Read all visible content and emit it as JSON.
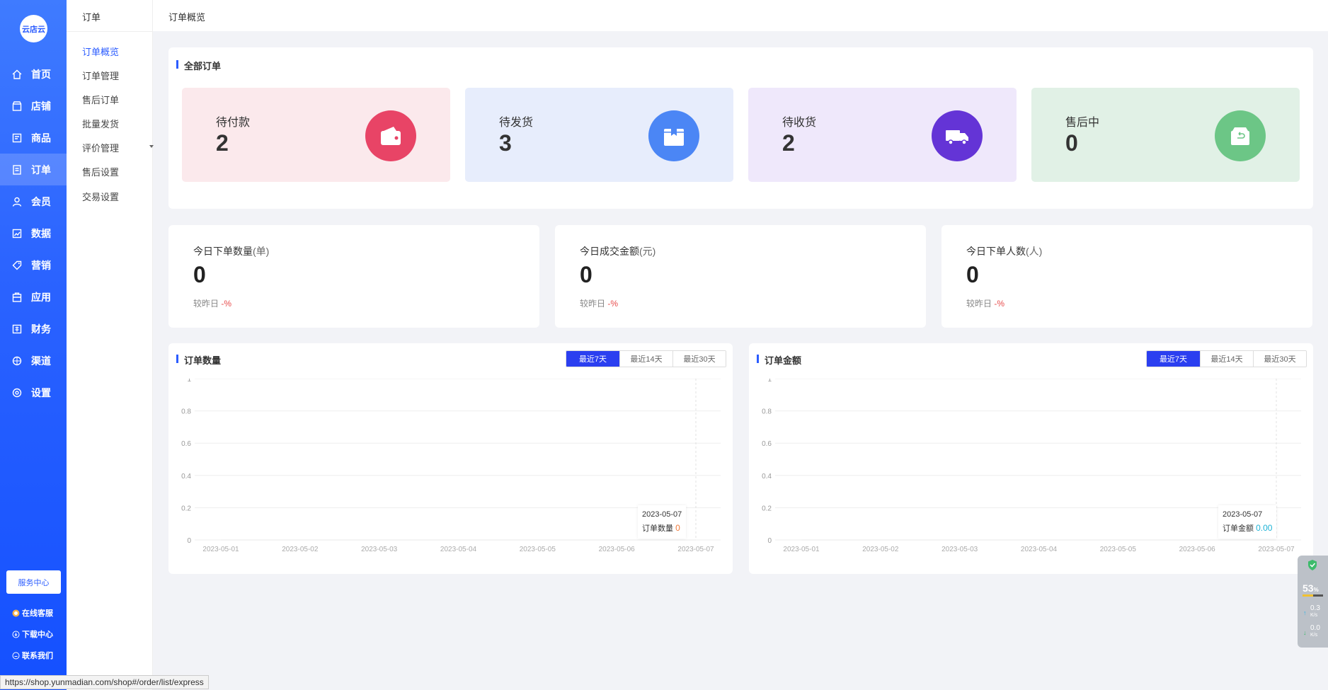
{
  "brand": {
    "logo_text": "云店云"
  },
  "nav": {
    "items": [
      {
        "label": "首页",
        "icon": "home-icon"
      },
      {
        "label": "店铺",
        "icon": "store-icon"
      },
      {
        "label": "商品",
        "icon": "goods-icon"
      },
      {
        "label": "订单",
        "icon": "order-icon"
      },
      {
        "label": "会员",
        "icon": "member-icon"
      },
      {
        "label": "数据",
        "icon": "data-icon"
      },
      {
        "label": "营销",
        "icon": "tag-icon"
      },
      {
        "label": "应用",
        "icon": "app-icon"
      },
      {
        "label": "财务",
        "icon": "finance-icon"
      },
      {
        "label": "渠道",
        "icon": "channel-icon"
      },
      {
        "label": "设置",
        "icon": "gear-icon"
      }
    ],
    "active": "订单",
    "service_center": "服务中心",
    "links": [
      {
        "label": "在线客服",
        "icon": "chat-icon"
      },
      {
        "label": "下载中心",
        "icon": "download-icon"
      },
      {
        "label": "联系我们",
        "icon": "contact-icon"
      }
    ]
  },
  "subnav": {
    "title": "订单",
    "items": [
      "订单概览",
      "订单管理",
      "售后订单",
      "批量发货",
      "评价管理",
      "售后设置",
      "交易设置"
    ],
    "active": "订单概览"
  },
  "header": {
    "breadcrumb": "订单概览"
  },
  "orders": {
    "title": "全部订单",
    "stats": [
      {
        "label": "待付款",
        "value": "2",
        "icon": "wallet-icon",
        "bg": "#fbe9ec",
        "circle": "#e84466"
      },
      {
        "label": "待发货",
        "value": "3",
        "icon": "box-icon",
        "bg": "#e7edfc",
        "circle": "#4b86f5"
      },
      {
        "label": "待收货",
        "value": "2",
        "icon": "truck-icon",
        "bg": "#efe8fb",
        "circle": "#6434d6"
      },
      {
        "label": "售后中",
        "value": "0",
        "icon": "return-box-icon",
        "bg": "#e1f1e6",
        "circle": "#6cc686"
      }
    ]
  },
  "today": [
    {
      "label": "今日下单数量",
      "unit": "(单)",
      "value": "0",
      "cmp_label": "较昨日",
      "cmp_value": "-%"
    },
    {
      "label": "今日成交金额",
      "unit": "(元)",
      "value": "0",
      "cmp_label": "较昨日",
      "cmp_value": "-%"
    },
    {
      "label": "今日下单人数",
      "unit": "(人)",
      "value": "0",
      "cmp_label": "较昨日",
      "cmp_value": "-%"
    }
  ],
  "chart_tabs": [
    "最近7天",
    "最近14天",
    "最近30天"
  ],
  "chart_data": [
    {
      "type": "line",
      "title": "订单数量",
      "x": [
        "2023-05-01",
        "2023-05-02",
        "2023-05-03",
        "2023-05-04",
        "2023-05-05",
        "2023-05-06",
        "2023-05-07"
      ],
      "series": [
        {
          "name": "订单数量",
          "values": [
            0,
            0,
            0,
            0,
            0,
            0,
            0
          ]
        }
      ],
      "ylim": [
        0,
        1
      ],
      "yticks": [
        "1",
        "0.8",
        "0.6",
        "0.4",
        "0.2",
        "0"
      ],
      "tooltip": {
        "date": "2023-05-07",
        "label": "订单数量",
        "value": "0",
        "color": "#f07a3a"
      },
      "grid": true
    },
    {
      "type": "line",
      "title": "订单金额",
      "x": [
        "2023-05-01",
        "2023-05-02",
        "2023-05-03",
        "2023-05-04",
        "2023-05-05",
        "2023-05-06",
        "2023-05-07"
      ],
      "series": [
        {
          "name": "订单金额",
          "values": [
            0,
            0,
            0,
            0,
            0,
            0,
            0
          ]
        }
      ],
      "ylim": [
        0,
        1
      ],
      "yticks": [
        "1",
        "0.8",
        "0.6",
        "0.4",
        "0.2",
        "0"
      ],
      "tooltip": {
        "date": "2023-05-07",
        "label": "订单金额",
        "value": "0.00",
        "color": "#1fb3d6"
      },
      "grid": true
    }
  ],
  "statusbar": {
    "url": "https://shop.yunmadian.com/shop#/order/list/express"
  },
  "widget": {
    "percent": "53",
    "percent_unit": "%",
    "up": "0.3",
    "up_unit": "K/s",
    "down": "0.0",
    "down_unit": "K/s"
  }
}
